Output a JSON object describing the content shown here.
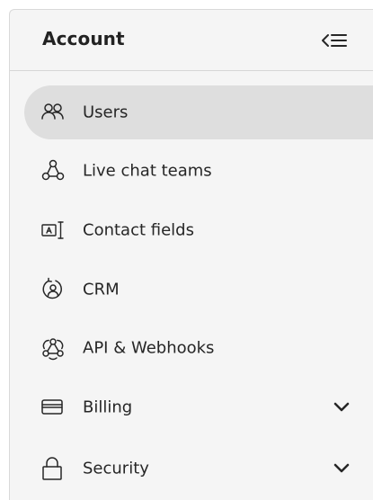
{
  "sidebar": {
    "title": "Account",
    "collapse_icon": "collapse-sidebar-icon",
    "items": [
      {
        "label": "Users",
        "icon": "users-icon",
        "active": true
      },
      {
        "label": "Live chat teams",
        "icon": "teams-icon"
      },
      {
        "label": "Contact fields",
        "icon": "contact-fields-icon"
      },
      {
        "label": "CRM",
        "icon": "crm-icon"
      },
      {
        "label": "API & Webhooks",
        "icon": "webhooks-icon"
      },
      {
        "label": "Billing",
        "icon": "credit-card-icon",
        "expandable": true
      },
      {
        "label": "Security",
        "icon": "lock-icon",
        "expandable": true
      }
    ]
  },
  "colors": {
    "background": "#f5f5f5",
    "active_item": "#dedede",
    "text": "#262626"
  }
}
